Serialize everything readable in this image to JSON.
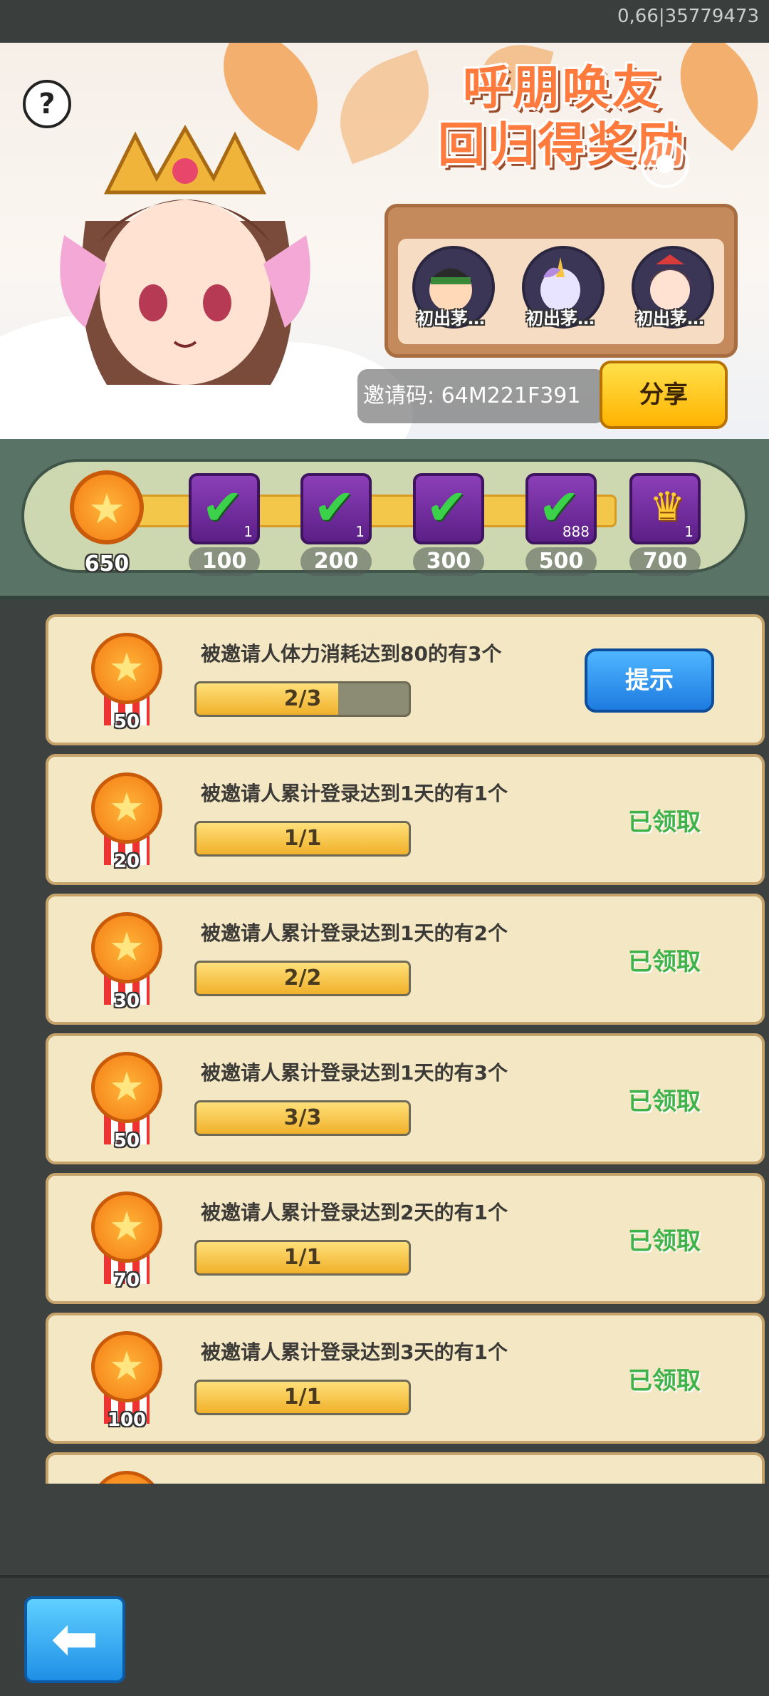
{
  "status_bar": {
    "build": "0,66|35779473"
  },
  "banner": {
    "help_label": "?",
    "title_line1": "呼朋唤友",
    "title_line2": "回归得奖励",
    "friends": [
      {
        "name": "初出茅…"
      },
      {
        "name": "初出茅…"
      },
      {
        "name": "初出茅…"
      }
    ],
    "invite_code_label": "邀请码: 64M221F391",
    "share_label": "分享"
  },
  "progress": {
    "total_score": "650",
    "milestones": [
      {
        "label": "100",
        "qty": "1",
        "claimed": true
      },
      {
        "label": "200",
        "qty": "1",
        "claimed": true
      },
      {
        "label": "300",
        "qty": "",
        "claimed": true
      },
      {
        "label": "500",
        "qty": "888",
        "claimed": true
      },
      {
        "label": "700",
        "qty": "1",
        "claimed": false
      }
    ]
  },
  "tasks": [
    {
      "points": "50",
      "desc": "被邀请人体力消耗达到80的有3个",
      "progress_text": "2/3",
      "progress": 0.6667,
      "action": "提示",
      "state": "hint"
    },
    {
      "points": "20",
      "desc": "被邀请人累计登录达到1天的有1个",
      "progress_text": "1/1",
      "progress": 1,
      "action": "已领取",
      "state": "claimed"
    },
    {
      "points": "30",
      "desc": "被邀请人累计登录达到1天的有2个",
      "progress_text": "2/2",
      "progress": 1,
      "action": "已领取",
      "state": "claimed"
    },
    {
      "points": "50",
      "desc": "被邀请人累计登录达到1天的有3个",
      "progress_text": "3/3",
      "progress": 1,
      "action": "已领取",
      "state": "claimed"
    },
    {
      "points": "70",
      "desc": "被邀请人累计登录达到2天的有1个",
      "progress_text": "1/1",
      "progress": 1,
      "action": "已领取",
      "state": "claimed"
    },
    {
      "points": "100",
      "desc": "被邀请人累计登录达到3天的有1个",
      "progress_text": "1/1",
      "progress": 1,
      "action": "已领取",
      "state": "claimed"
    }
  ],
  "footer": {
    "back_icon": "back-arrow-icon"
  }
}
